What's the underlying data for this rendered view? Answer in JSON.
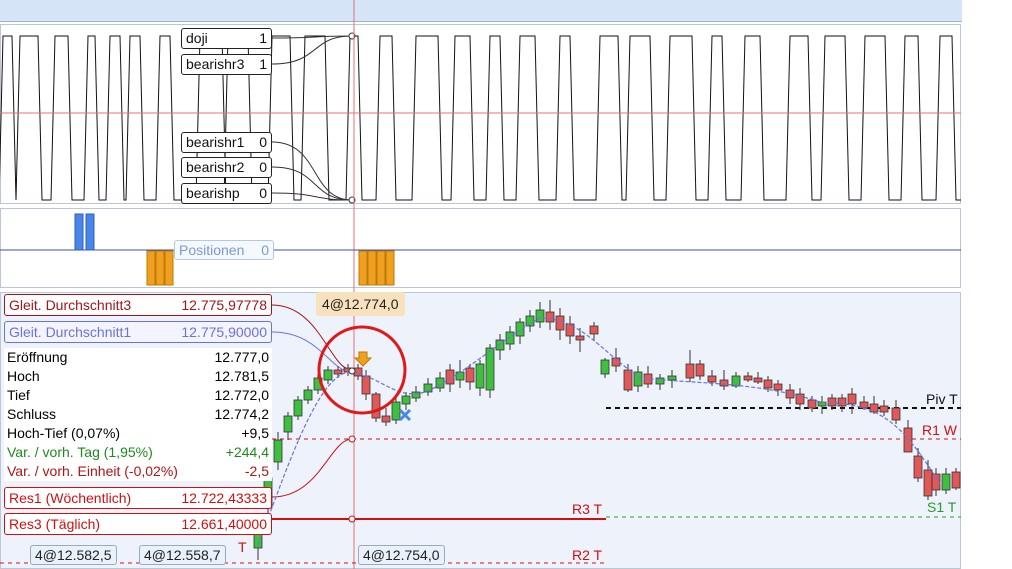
{
  "indicator_labels": [
    {
      "name": "doji",
      "value": "1"
    },
    {
      "name": "bearishr3",
      "value": "1"
    },
    {
      "name": "bearishr1",
      "value": "0"
    },
    {
      "name": "bearishr2",
      "value": "0"
    },
    {
      "name": "bearishp",
      "value": "0"
    }
  ],
  "positions": {
    "label": "Positionen",
    "value": "0"
  },
  "order_tag": "4@12.774,0",
  "moving_averages": [
    {
      "label": "Gleit. Durchschnitt3",
      "value": "12.775,97778",
      "color": "#a01616"
    },
    {
      "label": "Gleit. Durchschnitt1",
      "value": "12.775,90000",
      "color": "#6a73d8"
    }
  ],
  "ohlc": [
    {
      "label": "Eröffnung",
      "value": "12.777,0",
      "color": "#111111"
    },
    {
      "label": "Hoch",
      "value": "12.781,5",
      "color": "#111111"
    },
    {
      "label": "Tief",
      "value": "12.772,0",
      "color": "#111111"
    },
    {
      "label": "Schluss",
      "value": "12.774,2",
      "color": "#111111"
    },
    {
      "label": "Hoch-Tief (0,07%)",
      "value": "+9,5",
      "color": "#111111"
    },
    {
      "label": "Var. / vorh. Tag (1,95%)",
      "value": "+244,4",
      "color": "#1e8a1e"
    },
    {
      "label": "Var. / vorh. Einheit (-0,02%)",
      "value": "-2,5",
      "color": "#b01414"
    }
  ],
  "levels": [
    {
      "label": "Res1 (Wöchentlich)",
      "value": "12.722,43333",
      "color": "#d01010"
    },
    {
      "label": "Res3 (Täglich)",
      "value": "12.661,40000",
      "color": "#d01010"
    }
  ],
  "trade_tags": [
    "4@12.582,5",
    "4@12.558,7",
    "4@12.754,0"
  ],
  "pivot_labels": {
    "piv_t": "Piv T",
    "r1_w": "R1 W",
    "s1_t": "S1 T",
    "r3_t": "R3 T",
    "r2_t": "R2 T",
    "t_mark": "T"
  },
  "colors": {
    "bull": "#3fbf3f",
    "bear": "#e05858",
    "buy": "#4a86e8",
    "sell": "#f0a020",
    "crosshair": "#e87070"
  }
}
